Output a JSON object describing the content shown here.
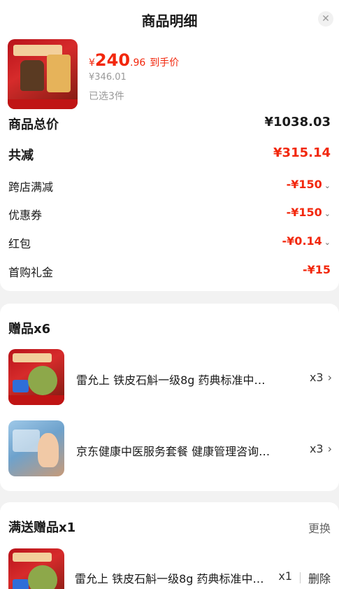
{
  "header": {
    "title": "商品明细",
    "close_icon": "close-icon"
  },
  "product": {
    "price_symbol": "¥",
    "price_int": "240",
    "price_dec": ".96",
    "price_tag": "到手价",
    "original_price": "¥346.01",
    "selected_count": "已选3件"
  },
  "summary": {
    "total_label": "商品总价",
    "total_value": "¥1038.03",
    "reduce_label": "共减",
    "reduce_value": "¥315.14",
    "items": [
      {
        "label": "跨店满减",
        "value": "-¥150"
      },
      {
        "label": "优惠券",
        "value": "-¥150"
      },
      {
        "label": "红包",
        "value": "-¥0.14"
      },
      {
        "label": "首购礼金",
        "value": "-¥15"
      }
    ]
  },
  "gifts": {
    "title": "赠品x6",
    "items": [
      {
        "name": "雷允上 铁皮石斛一级8g 药典标准中…",
        "qty": "x3",
        "arrow": "›"
      },
      {
        "name": "京东健康中医服务套餐 健康管理咨询…",
        "qty": "x3",
        "arrow": "›"
      }
    ]
  },
  "full_gift": {
    "title": "满送赠品x1",
    "swap_label": "更换",
    "item": {
      "name": "雷允上 铁皮石斛一级8g 药典标准中…",
      "qty": "x1",
      "delete_label": "删除"
    }
  },
  "colors": {
    "accent": "#f2270c",
    "background": "#f2f2f2"
  }
}
